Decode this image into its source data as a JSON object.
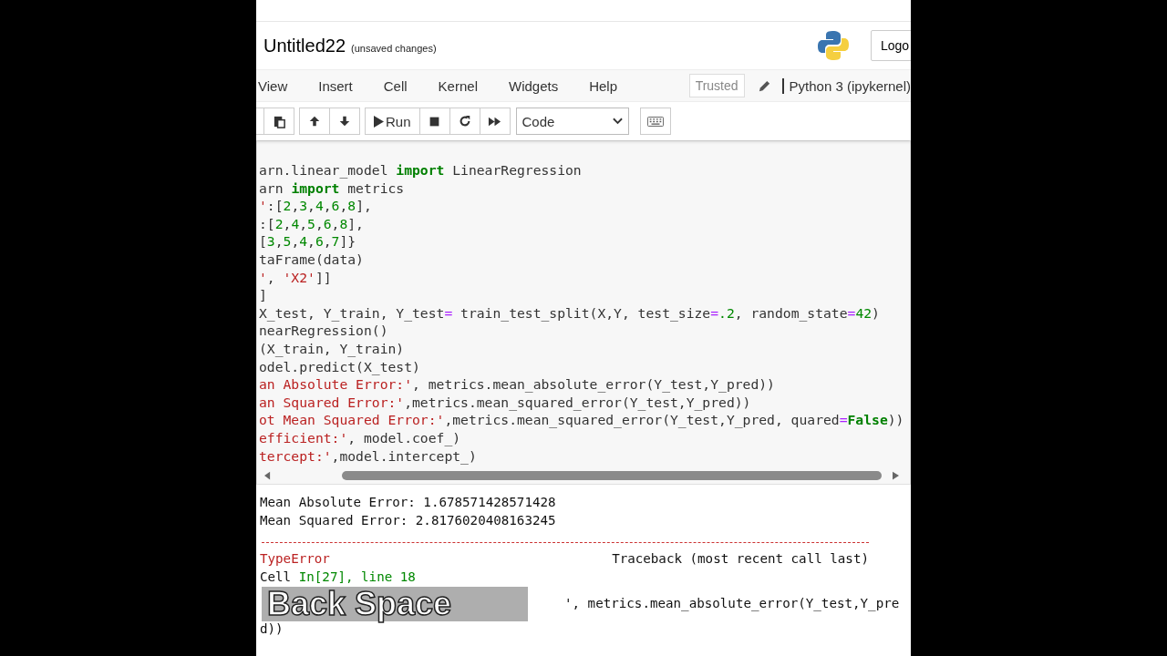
{
  "header": {
    "title": "Untitled22",
    "save_status": "(unsaved changes)",
    "logout_button": "Logo"
  },
  "menu": [
    "View",
    "Insert",
    "Cell",
    "Kernel",
    "Widgets",
    "Help"
  ],
  "trusted": "Trusted",
  "kernel": "Python 3 (ipykernel)",
  "toolbar": {
    "run": "Run",
    "cell_type": "Code"
  },
  "code_lines": [
    [
      {
        "t": "arn.linear_model ",
        "kind": "plain"
      },
      {
        "t": "import",
        "kind": "kw"
      },
      {
        "t": " LinearRegression",
        "kind": "plain"
      }
    ],
    [
      {
        "t": "arn ",
        "kind": "plain"
      },
      {
        "t": "import",
        "kind": "kw"
      },
      {
        "t": " metrics",
        "kind": "plain"
      }
    ],
    [
      {
        "t": "'",
        "kind": "str"
      },
      {
        "t": ":[",
        "kind": "plain"
      },
      {
        "t": "2",
        "kind": "num"
      },
      {
        "t": ",",
        "kind": "plain"
      },
      {
        "t": "3",
        "kind": "num"
      },
      {
        "t": ",",
        "kind": "plain"
      },
      {
        "t": "4",
        "kind": "num"
      },
      {
        "t": ",",
        "kind": "plain"
      },
      {
        "t": "6",
        "kind": "num"
      },
      {
        "t": ",",
        "kind": "plain"
      },
      {
        "t": "8",
        "kind": "num"
      },
      {
        "t": "],",
        "kind": "plain"
      }
    ],
    [
      {
        "t": ":[",
        "kind": "plain"
      },
      {
        "t": "2",
        "kind": "num"
      },
      {
        "t": ",",
        "kind": "plain"
      },
      {
        "t": "4",
        "kind": "num"
      },
      {
        "t": ",",
        "kind": "plain"
      },
      {
        "t": "5",
        "kind": "num"
      },
      {
        "t": ",",
        "kind": "plain"
      },
      {
        "t": "6",
        "kind": "num"
      },
      {
        "t": ",",
        "kind": "plain"
      },
      {
        "t": "8",
        "kind": "num"
      },
      {
        "t": "],",
        "kind": "plain"
      }
    ],
    [
      {
        "t": "[",
        "kind": "plain"
      },
      {
        "t": "3",
        "kind": "num"
      },
      {
        "t": ",",
        "kind": "plain"
      },
      {
        "t": "5",
        "kind": "num"
      },
      {
        "t": ",",
        "kind": "plain"
      },
      {
        "t": "4",
        "kind": "num"
      },
      {
        "t": ",",
        "kind": "plain"
      },
      {
        "t": "6",
        "kind": "num"
      },
      {
        "t": ",",
        "kind": "plain"
      },
      {
        "t": "7",
        "kind": "num"
      },
      {
        "t": "]}",
        "kind": "plain"
      }
    ],
    [
      {
        "t": "taFrame(data)",
        "kind": "plain"
      }
    ],
    [
      {
        "t": "'",
        "kind": "str"
      },
      {
        "t": ", ",
        "kind": "plain"
      },
      {
        "t": "'X2'",
        "kind": "str"
      },
      {
        "t": "]]",
        "kind": "plain"
      }
    ],
    [
      {
        "t": "]",
        "kind": "plain"
      }
    ],
    [
      {
        "t": "X_test, Y_train, Y_test",
        "kind": "plain"
      },
      {
        "t": "=",
        "kind": "op"
      },
      {
        "t": " train_test_split(X,Y, test_size",
        "kind": "plain"
      },
      {
        "t": "=",
        "kind": "op"
      },
      {
        "t": ".2",
        "kind": "num"
      },
      {
        "t": ", random_state",
        "kind": "plain"
      },
      {
        "t": "=",
        "kind": "op"
      },
      {
        "t": "42",
        "kind": "num"
      },
      {
        "t": ")",
        "kind": "plain"
      }
    ],
    [
      {
        "t": "nearRegression()",
        "kind": "plain"
      }
    ],
    [
      {
        "t": "(X_train, Y_train)",
        "kind": "plain"
      }
    ],
    [
      {
        "t": "odel.predict(X_test)",
        "kind": "plain"
      }
    ],
    [
      {
        "t": "an Absolute Error:'",
        "kind": "str"
      },
      {
        "t": ", metrics.mean_absolute_error(Y_test,Y_pred))",
        "kind": "plain"
      }
    ],
    [
      {
        "t": "an Squared Error:'",
        "kind": "str"
      },
      {
        "t": ",metrics.mean_squared_error(Y_test,Y_pred))",
        "kind": "plain"
      }
    ],
    [
      {
        "t": "ot Mean Squared Error:'",
        "kind": "str"
      },
      {
        "t": ",metrics.mean_squared_error(Y_test,Y_pred, quared",
        "kind": "plain"
      },
      {
        "t": "=",
        "kind": "op"
      },
      {
        "t": "False",
        "kind": "kw"
      },
      {
        "t": "))",
        "kind": "plain"
      }
    ],
    [
      {
        "t": "efficient:'",
        "kind": "str"
      },
      {
        "t": ", model.coef_)",
        "kind": "plain"
      }
    ],
    [
      {
        "t": "tercept:'",
        "kind": "str"
      },
      {
        "t": ",model.intercept_)",
        "kind": "plain"
      }
    ]
  ],
  "output": [
    "Mean Absolute Error: 1.678571428571428",
    "Mean Squared Error: 2.8176020408163245"
  ],
  "traceback": {
    "error": "TypeError",
    "heading": "Traceback (most recent call last)",
    "location": "Cell **In[27], line 18**",
    "line_tail": "', metrics.mean_absolute_error(Y_test,Y_pre",
    "line_end": "d))"
  },
  "key_caption": "Back Space"
}
